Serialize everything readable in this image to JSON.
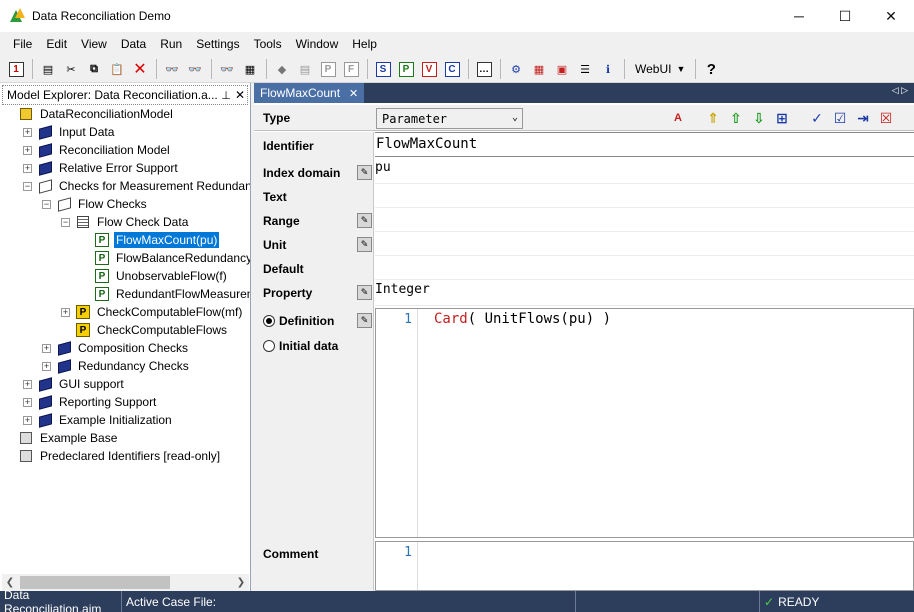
{
  "window": {
    "title": "Data Reconciliation Demo",
    "minimize_glyph": "─",
    "maximize_glyph": "☐",
    "close_glyph": "✕"
  },
  "menu": [
    "File",
    "Edit",
    "View",
    "Data",
    "Run",
    "Settings",
    "Tools",
    "Window",
    "Help"
  ],
  "toolbar": {
    "webui_label": "WebUI",
    "identifier_type_buttons": [
      "S",
      "P",
      "V",
      "C"
    ],
    "help_glyph": "?"
  },
  "explorer": {
    "title": "Model Explorer: Data Reconciliation.a...",
    "pin_glyph": "📌",
    "close_glyph": "✕",
    "tree": [
      {
        "label": "DataReconciliationModel",
        "depth": 0,
        "icon": "cube-icon",
        "expander": "none"
      },
      {
        "label": "Input Data",
        "depth": 1,
        "icon": "book-icon",
        "expander": "+"
      },
      {
        "label": "Reconciliation Model",
        "depth": 1,
        "icon": "book-icon",
        "expander": "+"
      },
      {
        "label": "Relative Error Support",
        "depth": 1,
        "icon": "book-icon",
        "expander": "+"
      },
      {
        "label": "Checks for Measurement Redundanc",
        "depth": 1,
        "icon": "open-book-icon",
        "expander": "−"
      },
      {
        "label": "Flow Checks",
        "depth": 2,
        "icon": "open-book-icon",
        "expander": "−"
      },
      {
        "label": "Flow Check Data",
        "depth": 3,
        "icon": "declaration-icon",
        "expander": "−"
      },
      {
        "label": "FlowMaxCount(pu)",
        "depth": 4,
        "icon": "parameter-icon",
        "expander": "none",
        "selected": true
      },
      {
        "label": "FlowBalanceRedundancy",
        "depth": 4,
        "icon": "parameter-icon",
        "expander": "none"
      },
      {
        "label": "UnobservableFlow(f)",
        "depth": 4,
        "icon": "parameter-icon",
        "expander": "none"
      },
      {
        "label": "RedundantFlowMeasurem",
        "depth": 4,
        "icon": "parameter-icon",
        "expander": "none"
      },
      {
        "label": "CheckComputableFlow(mf)",
        "depth": 3,
        "icon": "procedure-icon",
        "expander": "+"
      },
      {
        "label": "CheckComputableFlows",
        "depth": 3,
        "icon": "procedure-icon",
        "expander": "none"
      },
      {
        "label": "Composition Checks",
        "depth": 2,
        "icon": "book-icon",
        "expander": "+"
      },
      {
        "label": "Redundancy Checks",
        "depth": 2,
        "icon": "book-icon",
        "expander": "+"
      },
      {
        "label": "GUI support",
        "depth": 1,
        "icon": "book-icon",
        "expander": "+"
      },
      {
        "label": "Reporting Support",
        "depth": 1,
        "icon": "book-icon",
        "expander": "+"
      },
      {
        "label": "Example Initialization",
        "depth": 1,
        "icon": "book-icon",
        "expander": "+"
      },
      {
        "label": "Example Base",
        "depth": 0,
        "icon": "base-icon",
        "expander": "none"
      },
      {
        "label": "Predeclared Identifiers [read-only]",
        "depth": 0,
        "icon": "base-icon",
        "expander": "none"
      }
    ]
  },
  "editor": {
    "tab_label": "FlowMaxCount",
    "tab_close": "✕",
    "tab_nav": "◁ ▷",
    "type_label": "Type",
    "type_value": "Parameter",
    "fields": {
      "identifier_label": "Identifier",
      "identifier_value": "FlowMaxCount",
      "index_domain_label": "Index domain",
      "index_domain_value": "pu",
      "text_label": "Text",
      "text_value": "",
      "range_label": "Range",
      "range_value": "",
      "unit_label": "Unit",
      "unit_value": "",
      "default_label": "Default",
      "default_value": "",
      "property_label": "Property",
      "property_value": "Integer",
      "definition_label": "Definition",
      "initial_data_label": "Initial data",
      "comment_label": "Comment"
    },
    "definition": {
      "line_number": "1",
      "keyword": "Card",
      "rest": "( UnitFlows(pu) )"
    },
    "comment": {
      "line_number": "1",
      "text": ""
    }
  },
  "status": {
    "file": "Data Reconciliation.aim",
    "active_case": "Active Case File:",
    "state": "READY"
  },
  "colors": {
    "selection": "#0078d7",
    "status_bar": "#2d3e5c",
    "tab_active": "#4a6fa5",
    "keyword": "#c41e1e",
    "line_numbers": "#2b74b8"
  }
}
